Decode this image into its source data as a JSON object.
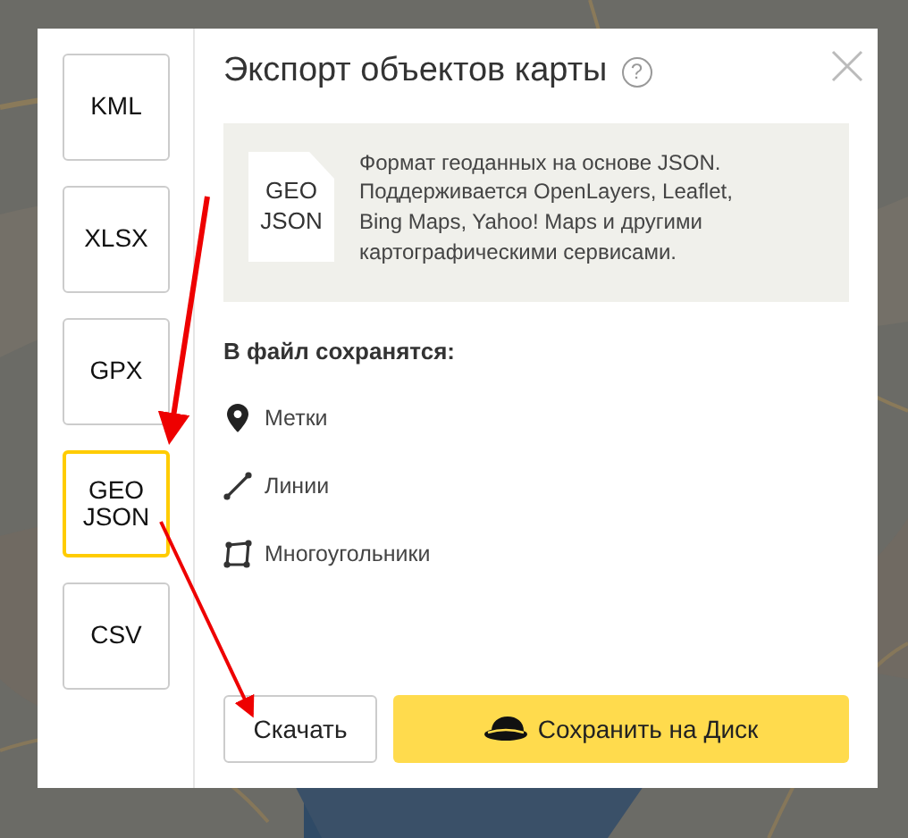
{
  "dialog": {
    "title": "Экспорт объектов карты",
    "help": "?",
    "formats": [
      {
        "label": "KML",
        "selected": false
      },
      {
        "label": "XLSX",
        "selected": false
      },
      {
        "label": "GPX",
        "selected": false
      },
      {
        "label": "GEO\nJSON",
        "selected": true
      },
      {
        "label": "CSV",
        "selected": false
      }
    ],
    "info": {
      "file_label": "GEO\nJSON",
      "description": "Формат геоданных на основе JSON. Поддерживается OpenLayers, Leaflet, Bing Maps, Yahoo! Maps и другими картографическими сервисами."
    },
    "saved_heading": "В файл сохранятся:",
    "saved_items": [
      {
        "kind": "placemark",
        "label": "Метки"
      },
      {
        "kind": "line",
        "label": "Линии"
      },
      {
        "kind": "polygon",
        "label": "Многоугольники"
      }
    ],
    "buttons": [
      {
        "kind": "plain",
        "label": "Скачать"
      },
      {
        "kind": "disk",
        "label": "Сохранить на Диск"
      }
    ]
  }
}
